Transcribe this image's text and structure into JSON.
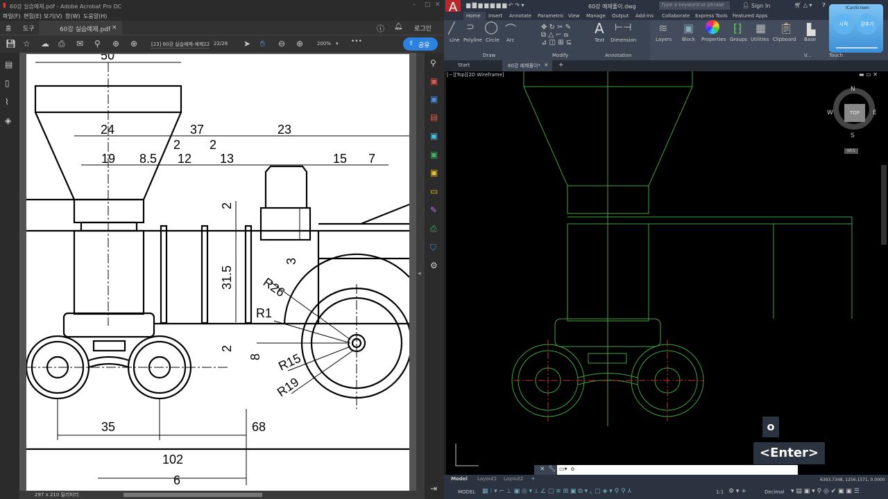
{
  "acrobat": {
    "title": "60강 실습예제.pdf - Adobe Acrobat Pro DC",
    "menu": [
      "파일(F)",
      "편집(E)",
      "보기(V)",
      "창(W)",
      "도움말(H)"
    ],
    "nav_home": "홈",
    "nav_tools": "도구",
    "tab_label": "60강 실습예제.pdf",
    "login": "로그인",
    "bookmark": "[23] 60강 실습예제-예제22",
    "page": "22/28",
    "zoom": "200%",
    "share": "공유",
    "page_size": "297 x 210 밀리미터"
  },
  "drawing": {
    "dims": [
      "50",
      "24",
      "37",
      "23",
      "19",
      "8.5",
      "2",
      "12",
      "2",
      "13",
      "15",
      "7",
      "2",
      "31.5",
      "3",
      "R26",
      "R1",
      "2",
      "8",
      "R15",
      "R19",
      "35",
      "68",
      "102",
      "6"
    ]
  },
  "autocad": {
    "file": "60강 예제풀이.dwg",
    "search_placeholder": "Type a keyword or phrase",
    "sign_in": "Sign In",
    "ribbon_tabs": [
      "Home",
      "Insert",
      "Annotate",
      "Parametric",
      "View",
      "Manage",
      "Output",
      "Add-ins",
      "Collaborate",
      "Express Tools",
      "Featured Apps"
    ],
    "draw_tools": [
      "Line",
      "Polyline",
      "Circle",
      "Arc"
    ],
    "annot_tools": [
      "Text",
      "Dimension"
    ],
    "big_tools": [
      "Layers",
      "Block",
      "Properties",
      "Groups",
      "Utilities",
      "Clipboard",
      "Base"
    ],
    "panels": [
      "Draw",
      "Modify",
      "Annotation",
      "V...",
      "Touch"
    ],
    "doc_tabs": [
      "Start",
      "60강 예제풀이*"
    ],
    "viewport_label": "[−][Top][2D Wireframe]",
    "compass": {
      "n": "N",
      "s": "S",
      "e": "E",
      "w": "W",
      "top": "TOP",
      "wcs": "WCS"
    },
    "command_value": "o",
    "layout_tabs": [
      "Model",
      "Layout1",
      "Layout2"
    ],
    "coords": "6393.7348, 1256.1571, 0.0000",
    "model": "MODEL",
    "units": "Decimal",
    "scale": "1:1",
    "key_overlay": "o",
    "enter_overlay": "<Enter>"
  },
  "icanscreen": {
    "title": "ICanScreen",
    "start": "시작",
    "hide": "감추기"
  }
}
